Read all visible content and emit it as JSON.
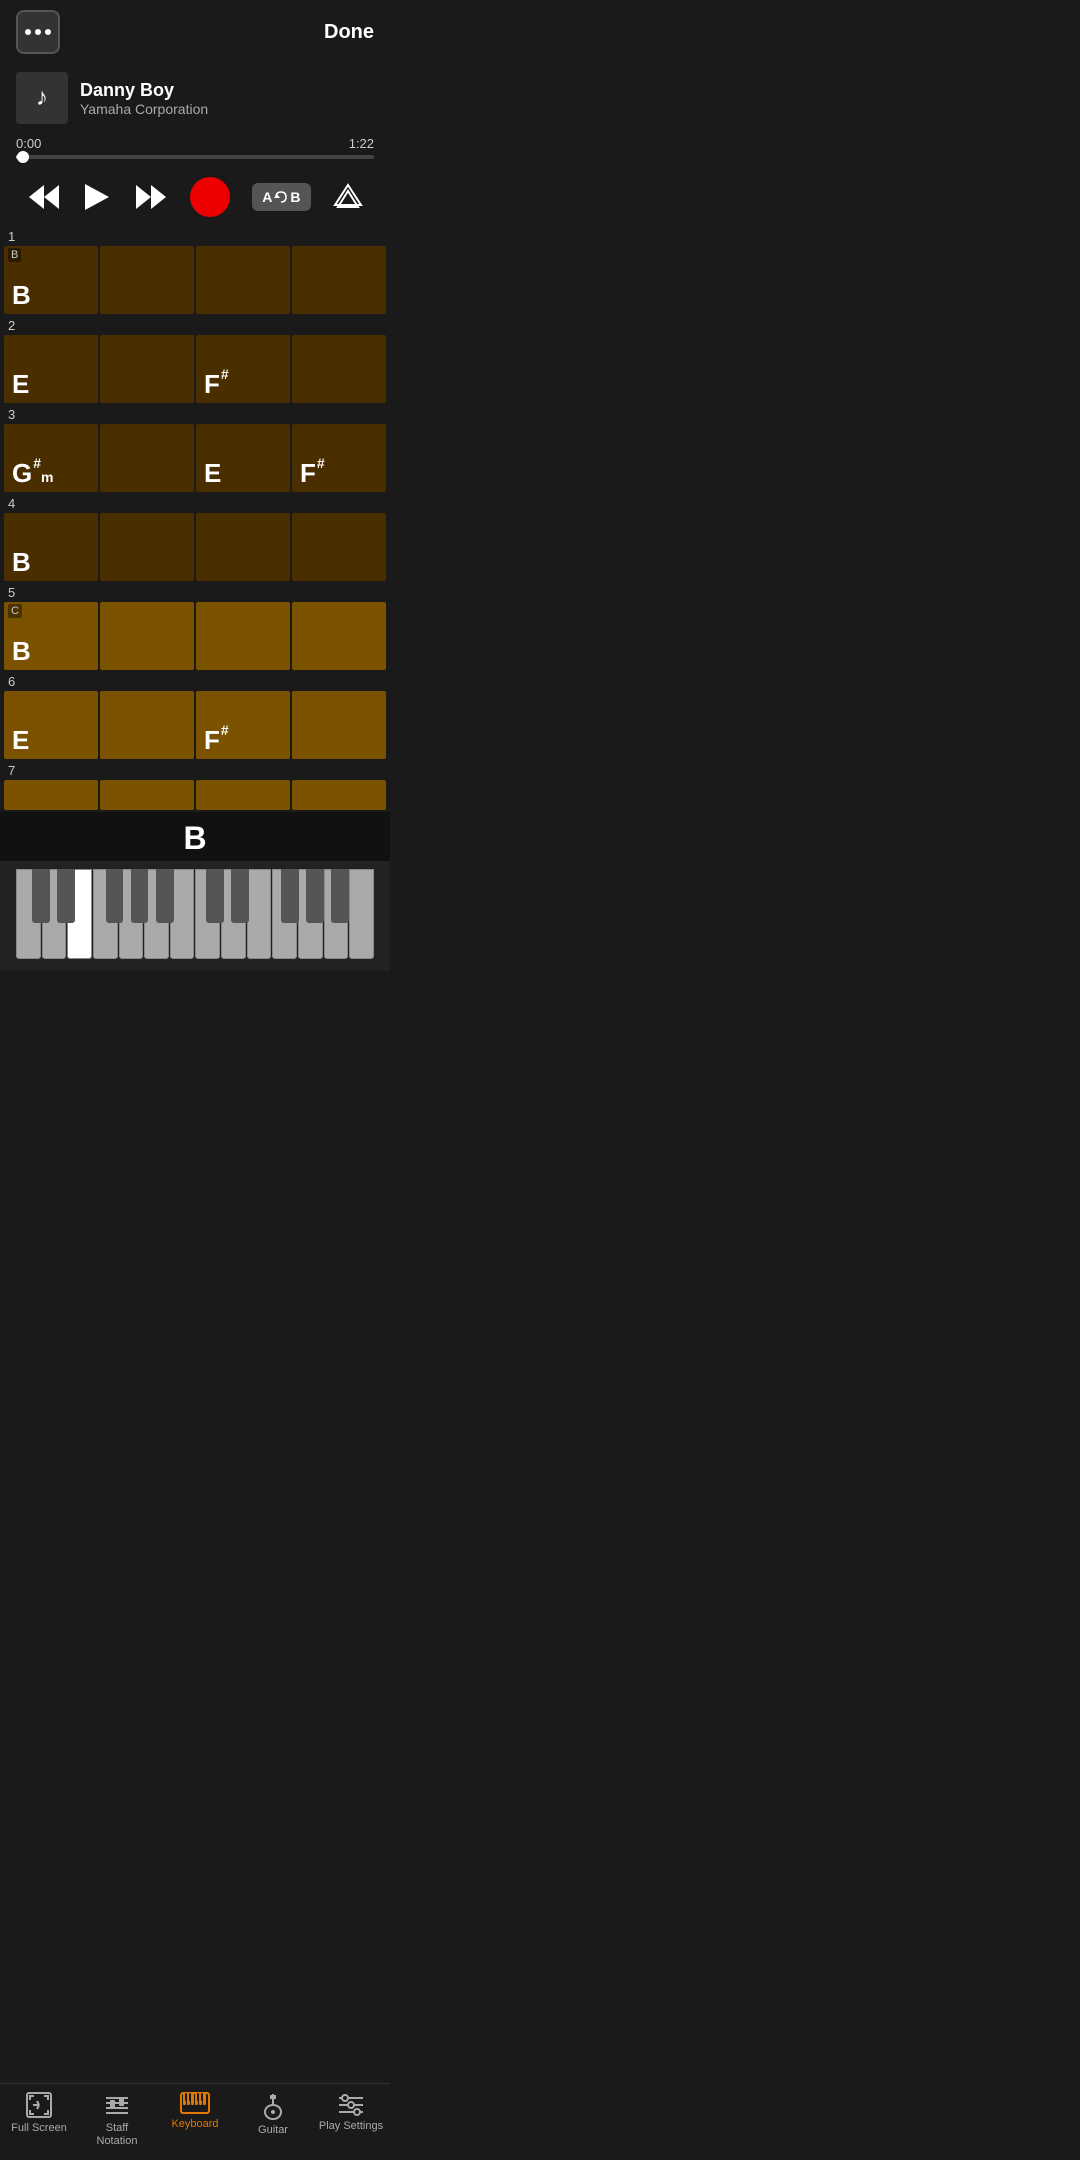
{
  "header": {
    "done_label": "Done",
    "menu_label": "..."
  },
  "song": {
    "title": "Danny Boy",
    "artist": "Yamaha Corporation"
  },
  "player": {
    "current_time": "0:00",
    "total_time": "1:22",
    "progress_percent": 2
  },
  "controls": {
    "rewind_label": "rewind",
    "play_label": "play",
    "fast_forward_label": "fast-forward",
    "record_label": "record",
    "ab_label": "A⟳B",
    "priority_label": "priority"
  },
  "measures": [
    {
      "number": "1",
      "section_marker": "B",
      "cells": [
        {
          "chord": "B",
          "modifier": "",
          "sub": "",
          "type": "dark",
          "active": true
        },
        {
          "chord": "",
          "modifier": "",
          "sub": "",
          "type": "dark",
          "active": false
        },
        {
          "chord": "",
          "modifier": "",
          "sub": "",
          "type": "dark",
          "active": false
        },
        {
          "chord": "",
          "modifier": "",
          "sub": "",
          "type": "dark",
          "active": false
        }
      ]
    },
    {
      "number": "2",
      "section_marker": "",
      "cells": [
        {
          "chord": "E",
          "modifier": "",
          "sub": "",
          "type": "dark",
          "active": true
        },
        {
          "chord": "",
          "modifier": "",
          "sub": "",
          "type": "dark",
          "active": false
        },
        {
          "chord": "F",
          "modifier": "#",
          "sub": "",
          "type": "dark",
          "active": true
        },
        {
          "chord": "",
          "modifier": "",
          "sub": "",
          "type": "dark",
          "active": false
        }
      ]
    },
    {
      "number": "3",
      "section_marker": "",
      "cells": [
        {
          "chord": "G",
          "modifier": "#",
          "sub": "m",
          "type": "dark",
          "active": true
        },
        {
          "chord": "",
          "modifier": "",
          "sub": "",
          "type": "dark",
          "active": false
        },
        {
          "chord": "E",
          "modifier": "",
          "sub": "",
          "type": "dark",
          "active": true
        },
        {
          "chord": "F",
          "modifier": "#",
          "sub": "",
          "type": "dark",
          "active": true
        }
      ]
    },
    {
      "number": "4",
      "section_marker": "",
      "cells": [
        {
          "chord": "B",
          "modifier": "",
          "sub": "",
          "type": "dark",
          "active": true
        },
        {
          "chord": "",
          "modifier": "",
          "sub": "",
          "type": "dark",
          "active": false
        },
        {
          "chord": "",
          "modifier": "",
          "sub": "",
          "type": "dark",
          "active": false
        },
        {
          "chord": "",
          "modifier": "",
          "sub": "",
          "type": "dark",
          "active": false
        }
      ]
    },
    {
      "number": "5",
      "section_marker": "C",
      "cells": [
        {
          "chord": "B",
          "modifier": "",
          "sub": "",
          "type": "medium",
          "active": true
        },
        {
          "chord": "",
          "modifier": "",
          "sub": "",
          "type": "medium",
          "active": false
        },
        {
          "chord": "",
          "modifier": "",
          "sub": "",
          "type": "medium",
          "active": false
        },
        {
          "chord": "",
          "modifier": "",
          "sub": "",
          "type": "medium",
          "active": false
        }
      ]
    },
    {
      "number": "6",
      "section_marker": "",
      "cells": [
        {
          "chord": "E",
          "modifier": "",
          "sub": "",
          "type": "medium",
          "active": true
        },
        {
          "chord": "",
          "modifier": "",
          "sub": "",
          "type": "medium",
          "active": false
        },
        {
          "chord": "F",
          "modifier": "#",
          "sub": "",
          "type": "medium",
          "active": true
        },
        {
          "chord": "",
          "modifier": "",
          "sub": "",
          "type": "medium",
          "active": false
        }
      ]
    },
    {
      "number": "7",
      "section_marker": "",
      "cells": [
        {
          "chord": "",
          "modifier": "",
          "sub": "",
          "type": "medium",
          "active": false
        },
        {
          "chord": "",
          "modifier": "",
          "sub": "",
          "type": "medium",
          "active": false
        },
        {
          "chord": "",
          "modifier": "",
          "sub": "",
          "type": "medium",
          "active": false
        },
        {
          "chord": "",
          "modifier": "",
          "sub": "",
          "type": "medium",
          "active": false
        }
      ]
    }
  ],
  "current_chord": "B",
  "keyboard": {
    "white_keys_count": 14,
    "active_white_keys": [
      4
    ]
  },
  "tab_bar": {
    "items": [
      {
        "id": "full-screen",
        "label": "Full Screen",
        "active": false
      },
      {
        "id": "staff-notation",
        "label": "Staff\nNotation",
        "active": false
      },
      {
        "id": "keyboard",
        "label": "Keyboard",
        "active": true
      },
      {
        "id": "guitar",
        "label": "Guitar",
        "active": false
      },
      {
        "id": "play-settings",
        "label": "Play Settings",
        "active": false
      }
    ]
  }
}
